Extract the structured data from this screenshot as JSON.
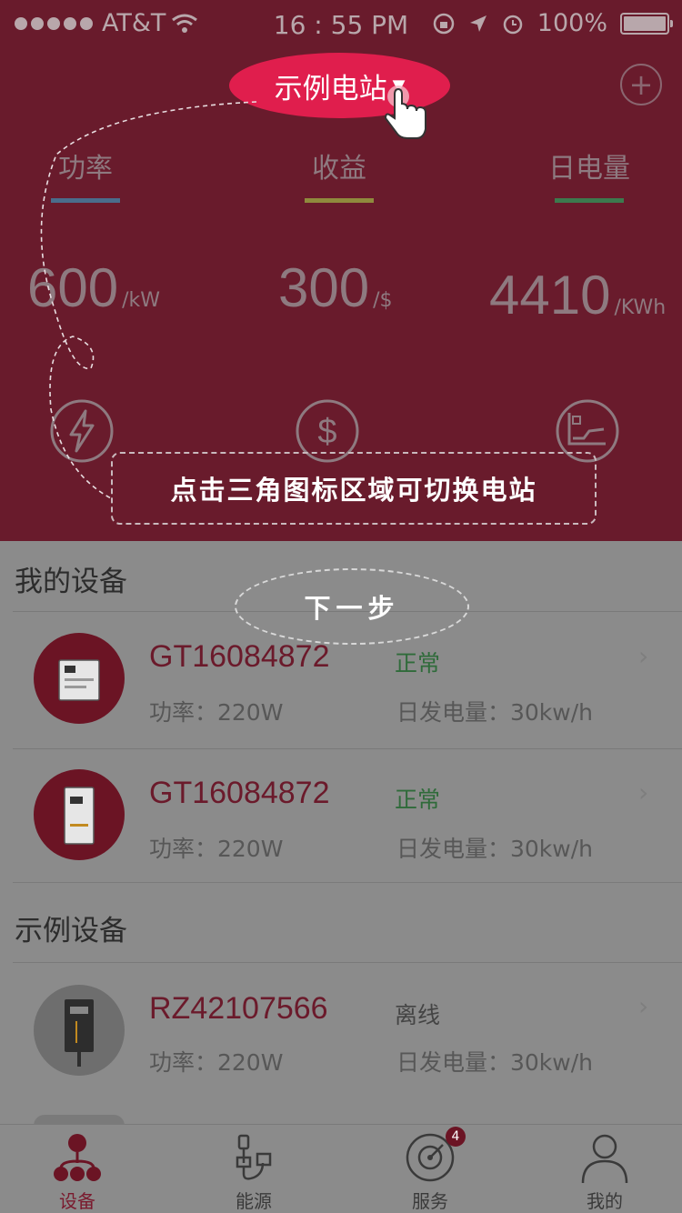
{
  "status_bar": {
    "carrier": "AT&T",
    "time": "16 : 55 PM",
    "battery": "100%"
  },
  "header": {
    "station_name": "示例电站",
    "add_icon": "plus-circle-icon"
  },
  "tabs": [
    {
      "label": "功率",
      "color": "#4a6d8c"
    },
    {
      "label": "收益",
      "color": "#8f8a3d"
    },
    {
      "label": "日电量",
      "color": "#3c7a4e"
    }
  ],
  "metrics": [
    {
      "value": "600",
      "unit": "/kW",
      "icon": "lightning-icon"
    },
    {
      "value": "300",
      "unit": "/$",
      "icon": "dollar-icon"
    },
    {
      "value": "4410",
      "unit": "/KWh",
      "icon": "line-chart-icon"
    }
  ],
  "guide": {
    "tip": "点击三角图标区域可切换电站",
    "next": "下一步"
  },
  "my_devices": {
    "title": "我的设备",
    "items": [
      {
        "id": "GT16084872",
        "status": "正常",
        "power": "功率：220W",
        "energy": "日发电量：30kw/h"
      },
      {
        "id": "GT16084872",
        "status": "正常",
        "power": "功率：220W",
        "energy": "日发电量：30kw/h"
      }
    ]
  },
  "sample_devices": {
    "title": "示例设备",
    "items": [
      {
        "id": "RZ42107566",
        "status": "离线",
        "power": "功率：220W",
        "energy": "日发电量：30kw/h"
      }
    ]
  },
  "bottom_nav": [
    {
      "label": "设备",
      "icon": "device-tree-icon",
      "active": true
    },
    {
      "label": "能源",
      "icon": "energy-plug-icon"
    },
    {
      "label": "服务",
      "icon": "service-radar-icon",
      "badge": "4"
    },
    {
      "label": "我的",
      "icon": "user-icon"
    }
  ],
  "colors": {
    "header_bg": "#691b2c",
    "pill": "#e01e4d",
    "status_ok": "#2f6b3a",
    "overlay": "#8b8b8b"
  }
}
